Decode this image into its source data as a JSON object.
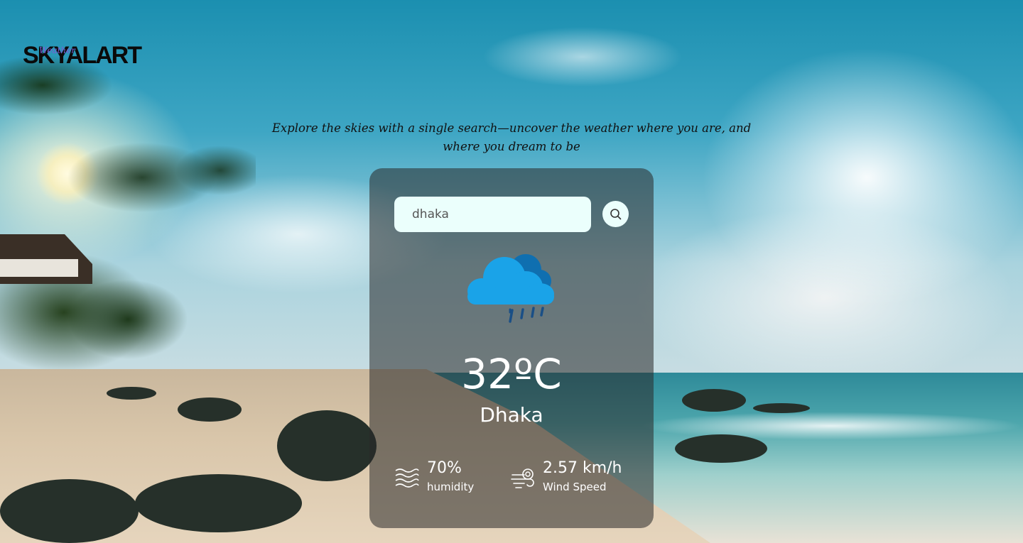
{
  "brand": {
    "logo_text": "SKYALART",
    "logo_sub": "Weather"
  },
  "tagline": "Explore the skies with a single search—uncover the weather where you are, and where you dream to be",
  "search": {
    "value": "dhaka",
    "button_icon": "search-icon"
  },
  "weather": {
    "icon": "rain-cloud-icon",
    "temperature": "32ºC",
    "city": "Dhaka",
    "humidity": {
      "value": "70%",
      "label": "humidity",
      "icon": "humidity-icon"
    },
    "wind": {
      "value": "2.57 km/h",
      "label": "Wind Speed",
      "icon": "wind-icon"
    }
  },
  "colors": {
    "input_bg": "#ebfffc",
    "card_bg": "rgba(40,40,40,0.55)",
    "cloud_blue": "#1aa3e8",
    "cloud_dark": "#0f6fb0"
  }
}
